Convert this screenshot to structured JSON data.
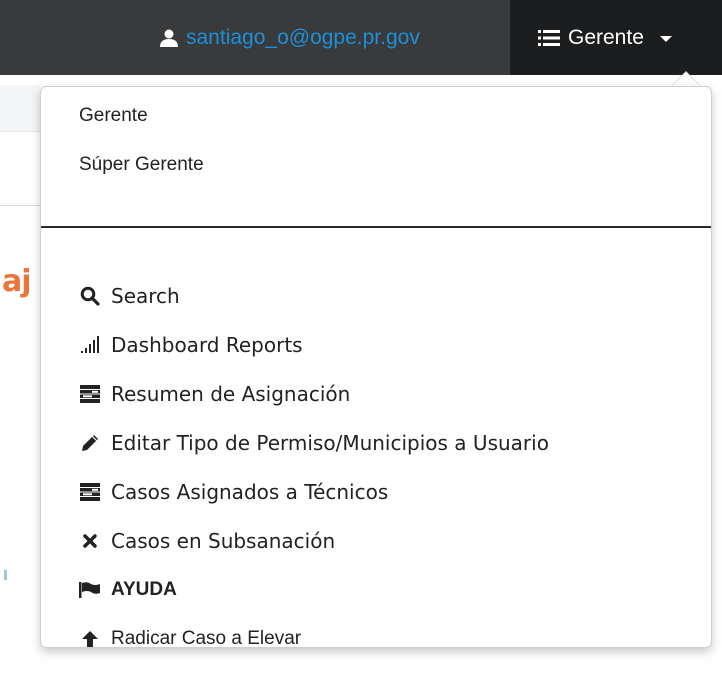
{
  "navbar": {
    "user_email": "santiago_o@ogpe.pr.gov",
    "role_label": "Gerente"
  },
  "background": {
    "partial_heading": "aj"
  },
  "dropdown": {
    "roles": [
      {
        "label": "Gerente"
      },
      {
        "label": "Súper Gerente"
      }
    ],
    "items": [
      {
        "label": "Search",
        "icon": "search-icon"
      },
      {
        "label": "Dashboard Reports",
        "icon": "signal-bars-icon"
      },
      {
        "label": "Resumen de Asignación",
        "icon": "tasks-icon"
      },
      {
        "label": "Editar Tipo de Permiso/Municipios a Usuario",
        "icon": "pencil-icon"
      },
      {
        "label": "Casos Asignados a Técnicos",
        "icon": "tasks-icon"
      },
      {
        "label": "Casos en Subsanación",
        "icon": "close-icon"
      },
      {
        "label": "AYUDA",
        "icon": "flag-icon"
      },
      {
        "label": "Radicar Caso a Elevar",
        "icon": "arrow-up-icon"
      }
    ]
  },
  "colors": {
    "navbar_bg": "#383a3c",
    "toggle_bg": "#1b1d1f",
    "link": "#1e8fd8",
    "accent_orange": "#e8753a"
  }
}
